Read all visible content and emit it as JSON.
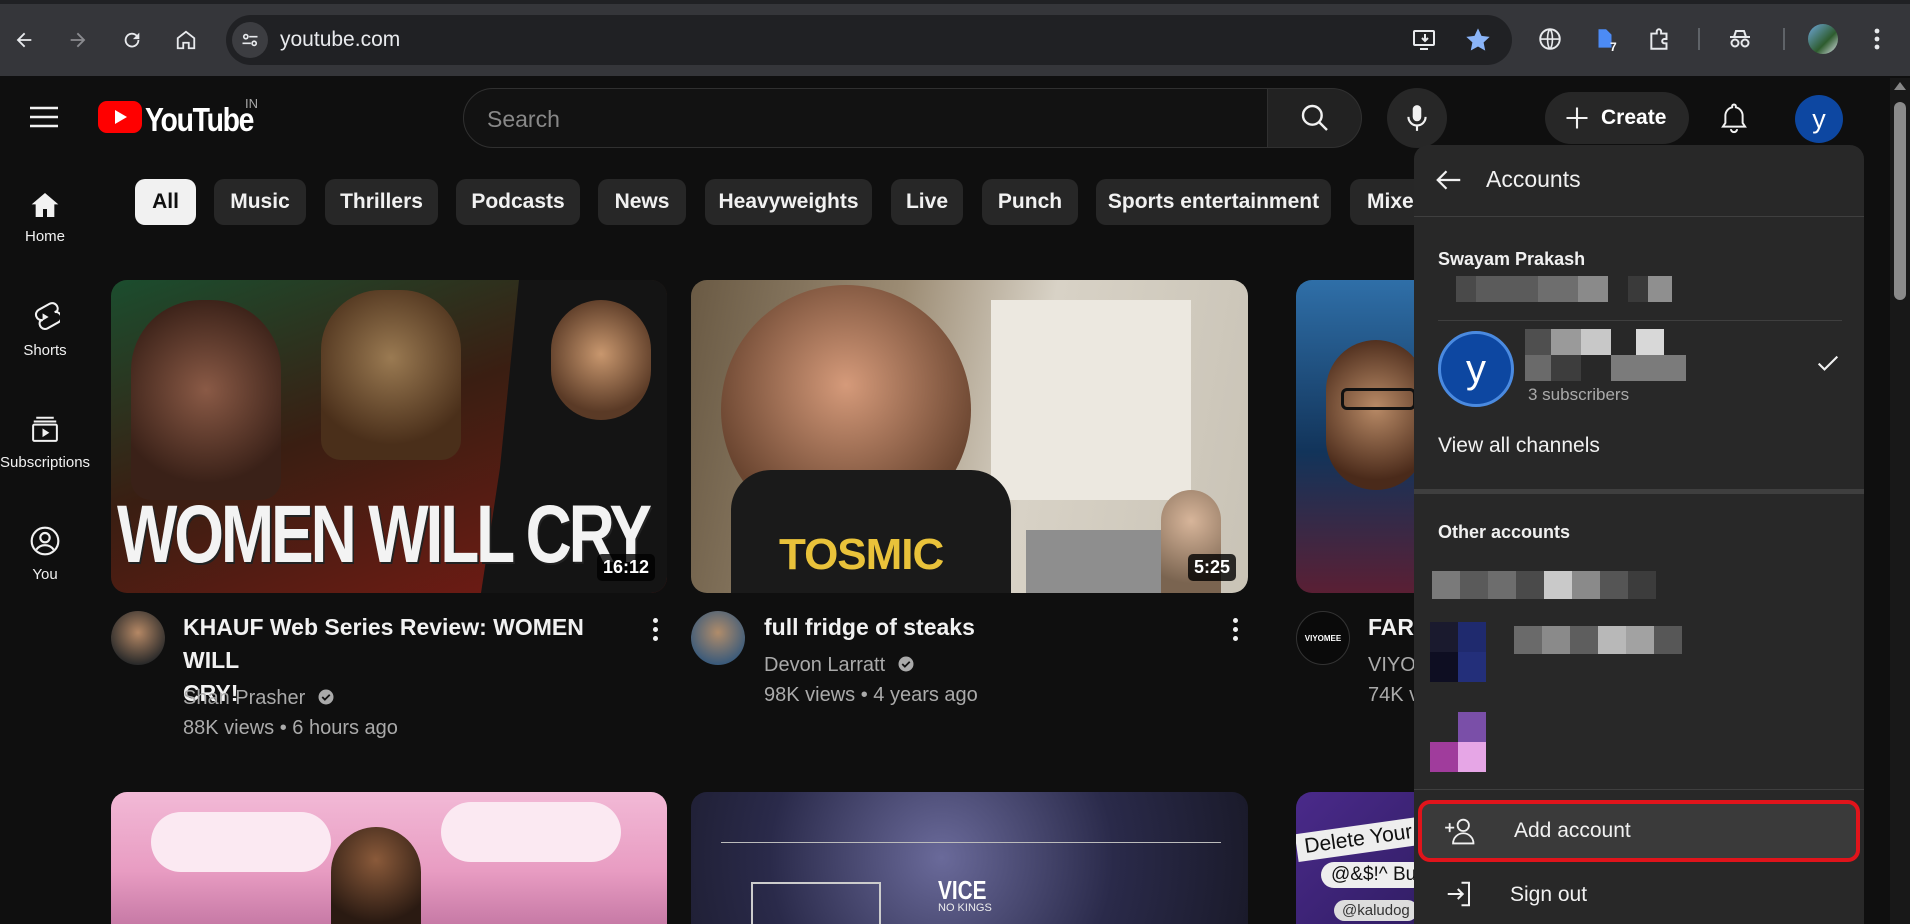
{
  "browser": {
    "url": "youtube.com",
    "extension_badge": "7"
  },
  "header": {
    "logo_text": "YouTube",
    "region": "IN",
    "search_placeholder": "Search",
    "create_label": "Create",
    "avatar_letter": "y"
  },
  "guide": [
    {
      "label": "Home",
      "icon": "home-icon"
    },
    {
      "label": "Shorts",
      "icon": "shorts-icon"
    },
    {
      "label": "Subscriptions",
      "icon": "subscriptions-icon"
    },
    {
      "label": "You",
      "icon": "you-icon"
    }
  ],
  "chips": [
    "All",
    "Music",
    "Thrillers",
    "Podcasts",
    "News",
    "Heavyweights",
    "Live",
    "Punch",
    "Sports entertainment",
    "Mixe"
  ],
  "videos": [
    {
      "thumb_text": "WOMEN WILL CRY",
      "duration": "16:12",
      "title_line1": "KHAUF Web Series Review: WOMEN WILL",
      "title_line2": "CRY!",
      "channel": "Shan Prasher",
      "meta": "88K views • 6 hours ago"
    },
    {
      "thumb_text": "TOSMIC",
      "duration": "5:25",
      "title_line1": "full fridge of steaks",
      "channel": "Devon Larratt",
      "meta": "98K views • 4 years ago"
    },
    {
      "title_line1": "FART",
      "channel": "VIYO",
      "meta": "74K v",
      "channel_logo_text": "VIYOMEE"
    }
  ],
  "row2": {
    "vice_text": "VICE",
    "vice_sub": "NO KINGS",
    "delete_text": "Delete Your C",
    "bubble_text": "@&$!^ Bu",
    "handle_text": "@kaludog"
  },
  "accounts_panel": {
    "title": "Accounts",
    "user_name": "Swayam Prakash",
    "channel_avatar_letter": "y",
    "subscribers": "3 subscribers",
    "view_all": "View all channels",
    "other_accounts": "Other accounts",
    "add_account": "Add account",
    "sign_out": "Sign out"
  },
  "colors": {
    "background": "#0f0f0f",
    "panel": "#282828",
    "youtube_red": "#ff0000",
    "highlight_red": "#e0141b",
    "avatar_blue": "#0d47a1"
  }
}
